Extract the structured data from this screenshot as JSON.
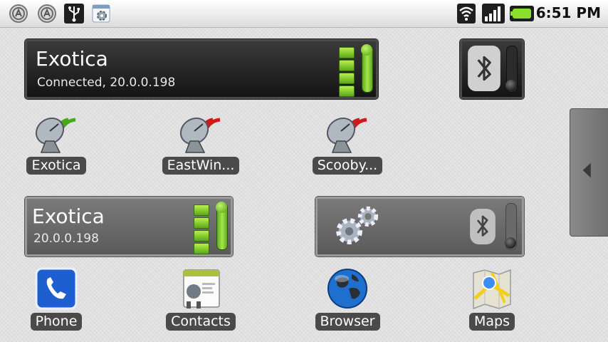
{
  "status_bar": {
    "time": "6:51 PM",
    "icons": [
      "app-store-icon",
      "app-store-icon",
      "usb-icon",
      "settings-icon",
      "wifi-icon",
      "signal-icon",
      "battery-icon"
    ]
  },
  "wifi_widget_large": {
    "ssid": "Exotica",
    "status": "Connected, 20.0.0.198"
  },
  "wifi_widget_small": {
    "ssid": "Exotica",
    "ip": "20.0.0.198"
  },
  "shortcuts": [
    {
      "label": "Exotica",
      "state": "connected"
    },
    {
      "label": "EastWin...",
      "state": "disconnected"
    },
    {
      "label": "Scooby...",
      "state": "disconnected"
    }
  ],
  "dock": [
    {
      "label": "Phone"
    },
    {
      "label": "Contacts"
    },
    {
      "label": "Browser"
    },
    {
      "label": "Maps"
    }
  ]
}
